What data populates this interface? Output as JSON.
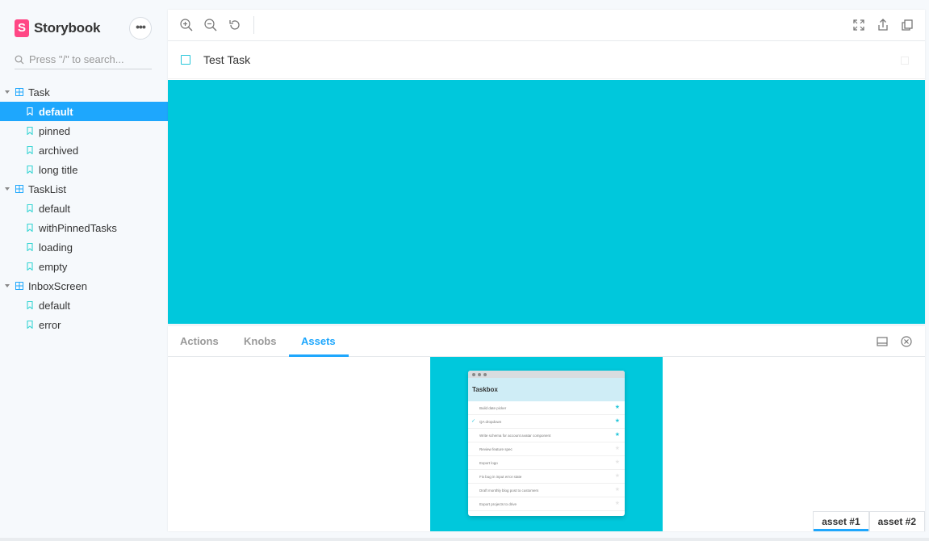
{
  "brand": {
    "logo_letter": "S",
    "name": "Storybook"
  },
  "menu": {
    "label": "•••"
  },
  "search": {
    "placeholder": "Press \"/\" to search..."
  },
  "tree": [
    {
      "name": "Task",
      "stories": [
        "default",
        "pinned",
        "archived",
        "long title"
      ]
    },
    {
      "name": "TaskList",
      "stories": [
        "default",
        "withPinnedTasks",
        "loading",
        "empty"
      ]
    },
    {
      "name": "InboxScreen",
      "stories": [
        "default",
        "error"
      ]
    }
  ],
  "selected_story": "Task / default",
  "preview": {
    "task_title": "Test Task",
    "background_color": "#00c8dc"
  },
  "panel": {
    "tabs": [
      "Actions",
      "Knobs",
      "Assets"
    ],
    "active_tab": "Assets",
    "asset_tabs": [
      "asset #1",
      "asset #2"
    ],
    "active_asset": "asset #1",
    "asset_image": {
      "title": "Taskbox",
      "items": [
        {
          "text": "Build date picker",
          "checked": false,
          "starred": true
        },
        {
          "text": "QA dropdown",
          "checked": true,
          "starred": true
        },
        {
          "text": "Write schema for account avatar component",
          "checked": false,
          "starred": true
        },
        {
          "text": "Review feature spec",
          "checked": false,
          "starred": false
        },
        {
          "text": "Export logo",
          "checked": false,
          "starred": false
        },
        {
          "text": "Fix bug in input error state",
          "checked": false,
          "starred": false
        },
        {
          "text": "Draft monthly blog post to customers",
          "checked": false,
          "starred": false
        },
        {
          "text": "Export projects to drive",
          "checked": false,
          "starred": false
        }
      ]
    }
  },
  "colors": {
    "accent": "#1ea7fd",
    "brand": "#ff4785",
    "teal": "#00c8dc"
  }
}
